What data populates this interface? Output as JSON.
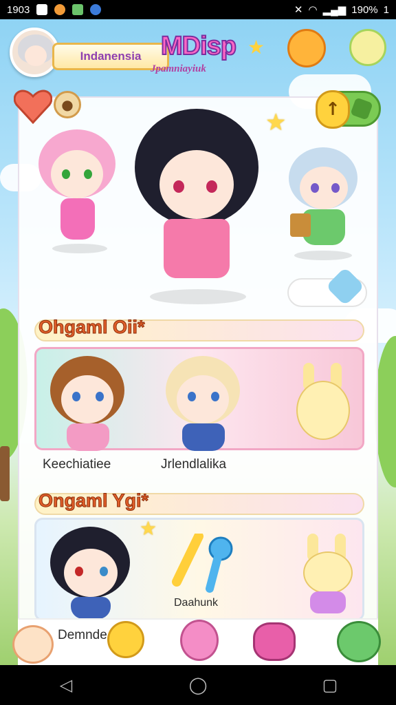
{
  "status_bar": {
    "time": "1903",
    "battery": "190%",
    "extra": "1"
  },
  "header": {
    "player_name": "Indanensia",
    "logo": "MDisp",
    "subtitle": "Jpamniayiuk"
  },
  "section1": {
    "title": "Ohgaml Oii*",
    "label_left": "Keechiatiee",
    "label_right": "Jrlendlalika"
  },
  "section2": {
    "title": "Ongaml Ygi*",
    "center_label": "Daahunk",
    "label_left": "Demnde"
  },
  "icons": {
    "heart": "heart-icon",
    "coin": "coin-icon",
    "up": "up-arrow-icon",
    "star": "star-icon"
  },
  "navigation": {
    "back": "◁",
    "home": "◯",
    "recent": "▢"
  }
}
